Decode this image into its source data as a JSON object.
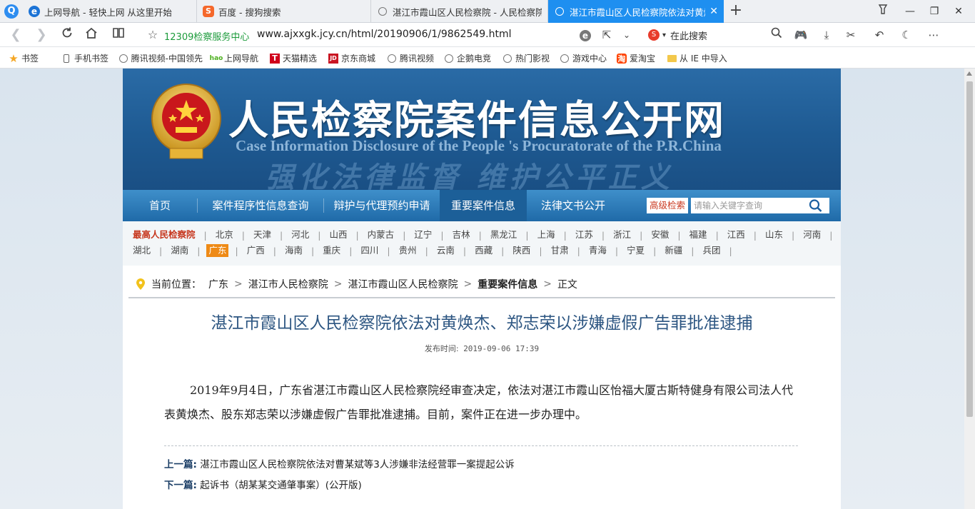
{
  "browser": {
    "tabs": [
      {
        "label": "上网导航 - 轻快上网 从这里开始",
        "icon": "ie-icon",
        "active": false
      },
      {
        "label": "百度 - 搜狗搜索",
        "icon": "sogou-icon",
        "active": false
      },
      {
        "label": "湛江市霞山区人民检察院 - 人民检察院",
        "icon": "globe-icon",
        "active": false
      },
      {
        "label": "湛江市霞山区人民检察院依法对黄焕杰",
        "icon": "globe-icon",
        "active": true
      }
    ],
    "site_name": "12309检察服务中心",
    "url": "www.ajxxgk.jcy.cn/html/20190906/1/9862549.html",
    "search_placeholder": "在此搜索",
    "bookmarks": [
      {
        "label": "书签",
        "icon": "star-icon"
      },
      {
        "label": "手机书签",
        "icon": "phone-icon"
      },
      {
        "label": "腾讯视频-中国领先",
        "icon": "globe-icon"
      },
      {
        "label": "上网导航",
        "icon": "hao-icon"
      },
      {
        "label": "天猫精选",
        "icon": "tmall-icon"
      },
      {
        "label": "京东商城",
        "icon": "jd-icon"
      },
      {
        "label": "腾讯视频",
        "icon": "globe-icon"
      },
      {
        "label": "企鹅电竞",
        "icon": "globe-icon"
      },
      {
        "label": "热门影视",
        "icon": "globe-icon"
      },
      {
        "label": "游戏中心",
        "icon": "globe-icon"
      },
      {
        "label": "爱淘宝",
        "icon": "taobao-icon"
      },
      {
        "label": "从 IE 中导入",
        "icon": "folder-icon"
      }
    ],
    "colors": {
      "tab_active": "#1e8ff0",
      "site_name": "#1c9b3b"
    }
  },
  "site": {
    "banner": {
      "title_cn": "人民检察院案件信息公开网",
      "title_en": "Case Information Disclosure of the People 's Procuratorate of the P.R.China",
      "slogan": "强化法律监督  维护公平正义"
    },
    "nav": [
      {
        "label": "首页",
        "active": false
      },
      {
        "label": "案件程序性信息查询",
        "active": false
      },
      {
        "label": "辩护与代理预约申请",
        "active": false
      },
      {
        "label": "重要案件信息",
        "active": true
      },
      {
        "label": "法律文书公开",
        "active": false
      }
    ],
    "advanced_search": "高级检索",
    "keyword_placeholder": "请输入关键字查询",
    "provinces_row1": [
      "最高人民检察院",
      "北京",
      "天津",
      "河北",
      "山西",
      "内蒙古",
      "辽宁",
      "吉林",
      "黑龙江",
      "上海",
      "江苏",
      "浙江",
      "安徽",
      "福建",
      "江西",
      "山东",
      "河南"
    ],
    "provinces_row2": [
      "湖北",
      "湖南",
      "广东",
      "广西",
      "海南",
      "重庆",
      "四川",
      "贵州",
      "云南",
      "西藏",
      "陕西",
      "甘肃",
      "青海",
      "宁夏",
      "新疆",
      "兵团"
    ],
    "selected_province": "广东",
    "colors": {
      "banner": "#1e5a92",
      "nav": "#2d7cbc",
      "highlight": "#ee8a16",
      "title": "#2d5682"
    }
  },
  "breadcrumb": {
    "label": "当前位置：",
    "items": [
      "广东",
      "湛江市人民检察院",
      "湛江市霞山区人民检察院",
      "重要案件信息",
      "正文"
    ]
  },
  "article": {
    "title": "湛江市霞山区人民检察院依法对黄焕杰、郑志荣以涉嫌虚假广告罪批准逮捕",
    "publish_label": "发布时间:",
    "publish_time": "2019-09-06 17:39",
    "body": "2019年9月4日，广东省湛江市霞山区人民检察院经审查决定，依法对湛江市霞山区怡福大厦古斯特健身有限公司法人代表黄焕杰、股东郑志荣以涉嫌虚假广告罪批准逮捕。目前，案件正在进一步办理中。",
    "prev_label": "上一篇:",
    "prev_title": "湛江市霞山区人民检察院依法对曹某斌等3人涉嫌非法经营罪一案提起公诉",
    "next_label": "下一篇:",
    "next_title": "起诉书（胡某某交通肇事案）(公开版)"
  }
}
